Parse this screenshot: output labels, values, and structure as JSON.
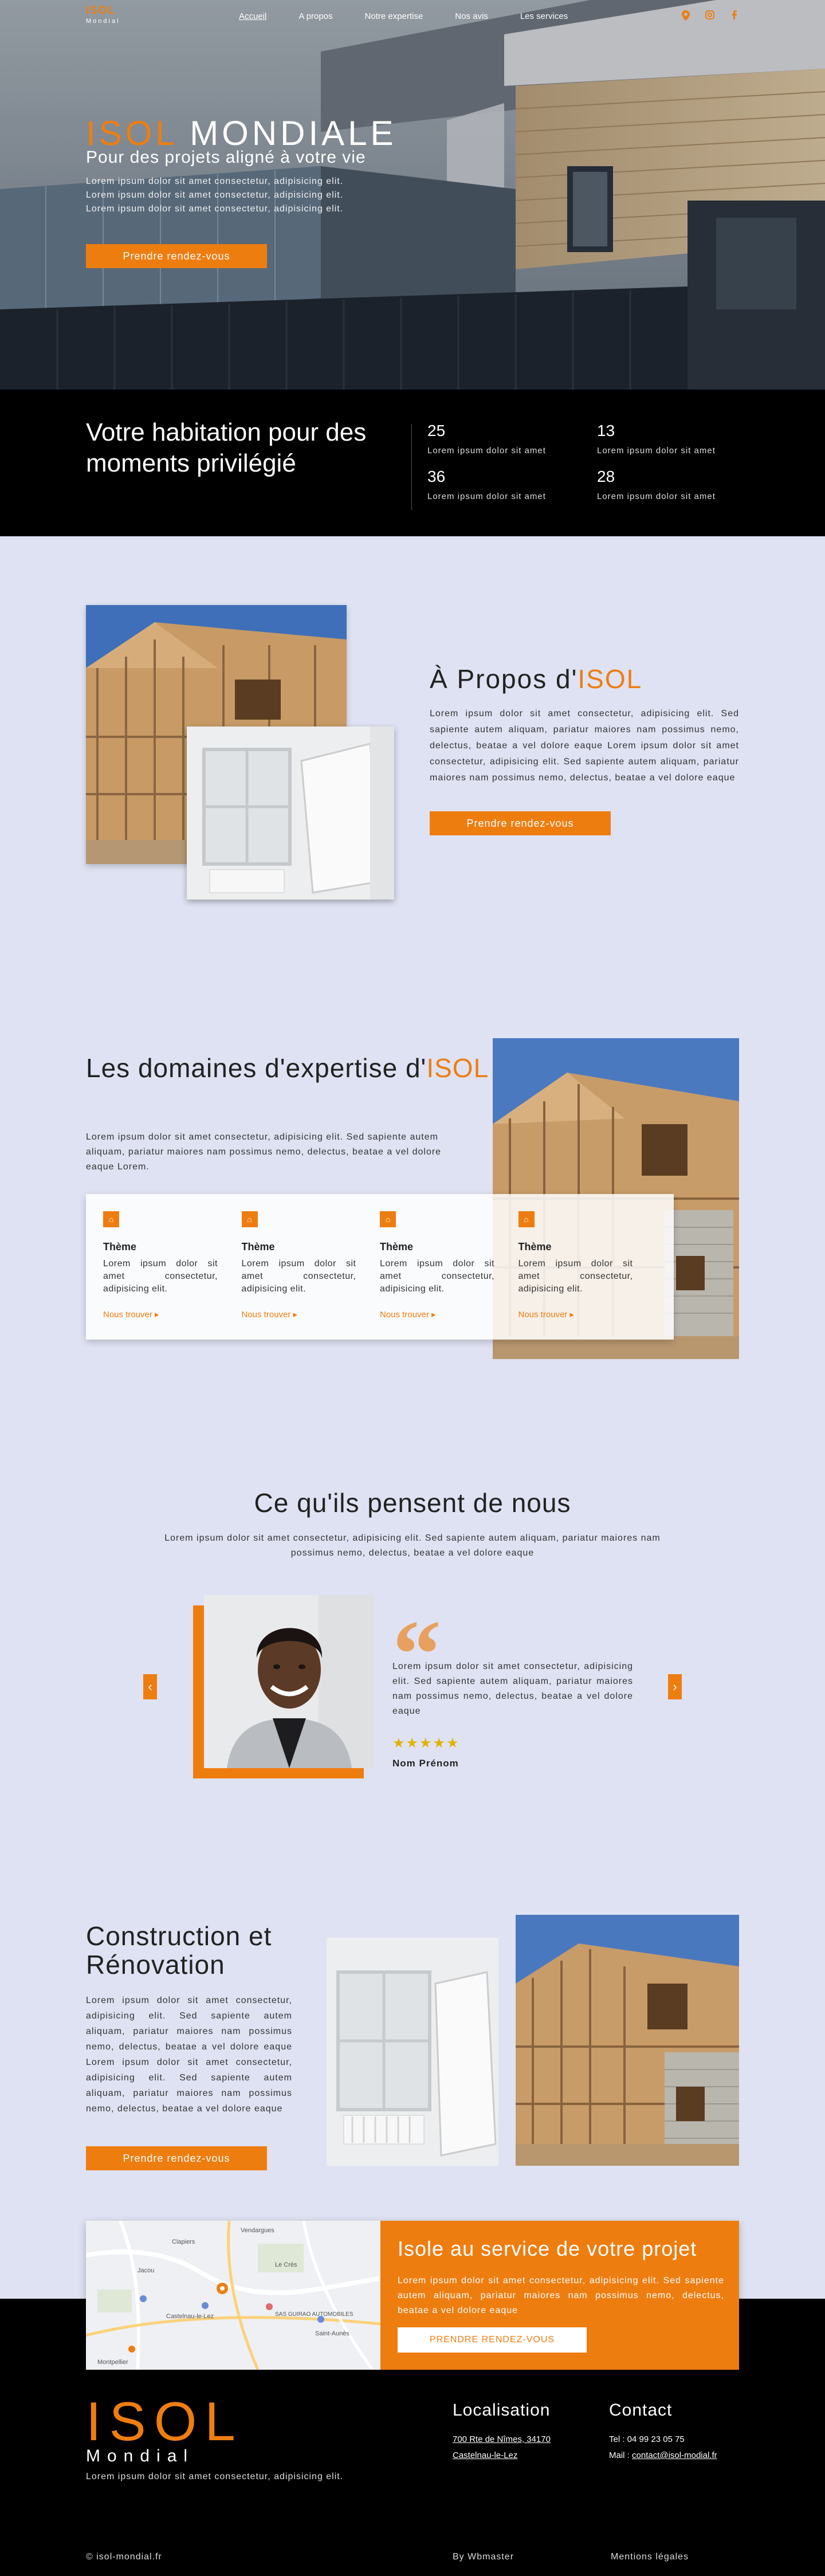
{
  "nav": {
    "logo_main": "ISOL",
    "logo_sub": "Mondial",
    "links": [
      "Accueil",
      "A propos",
      "Notre expertise",
      "Nos avis",
      "Les services"
    ]
  },
  "hero": {
    "title_accent": "ISOL",
    "title_rest": "MONDIALE",
    "subtitle": "Pour des projets aligné à votre vie",
    "text": "Lorem ipsum dolor sit amet consectetur, adipisicing elit. Lorem ipsum dolor sit amet consectetur, adipisicing elit. Lorem ipsum dolor sit amet consectetur, adipisicing elit.",
    "button": "Prendre rendez-vous"
  },
  "stats": {
    "title": "Votre habitation pour des moments privilégié",
    "items": [
      {
        "num": "25",
        "label": "Lorem ipsum dolor sit amet"
      },
      {
        "num": "13",
        "label": "Lorem ipsum dolor sit amet"
      },
      {
        "num": "36",
        "label": "Lorem ipsum dolor sit amet"
      },
      {
        "num": "28",
        "label": "Lorem ipsum dolor sit amet"
      }
    ]
  },
  "about": {
    "title_prefix": "À Propos d'",
    "title_accent": "ISOL",
    "text": "Lorem ipsum dolor sit amet consectetur, adipisicing elit. Sed sapiente autem aliquam, pariatur maiores nam possimus nemo, delectus, beatae a vel dolore eaque Lorem ipsum dolor sit amet consectetur, adipisicing elit. Sed sapiente autem aliquam, pariatur maiores nam possimus nemo, delectus, beatae a vel dolore eaque",
    "button": "Prendre rendez-vous"
  },
  "expertise": {
    "title_prefix": "Les domaines d'expertise d'",
    "title_accent": "ISOL",
    "text": "Lorem ipsum dolor sit amet consectetur, adipisicing elit. Sed sapiente autem aliquam, pariatur maiores nam possimus nemo, delectus, beatae a vel dolore eaque Lorem.",
    "cards": [
      {
        "title": "Thème",
        "text": "Lorem ipsum dolor sit amet consectetur, adipisicing elit.",
        "link": "Nous trouver"
      },
      {
        "title": "Thème",
        "text": "Lorem ipsum dolor sit amet consectetur, adipisicing elit.",
        "link": "Nous trouver"
      },
      {
        "title": "Thème",
        "text": "Lorem ipsum dolor sit amet consectetur, adipisicing elit.",
        "link": "Nous trouver"
      },
      {
        "title": "Thème",
        "text": "Lorem ipsum dolor sit amet consectetur, adipisicing elit.",
        "link": "Nous trouver"
      }
    ]
  },
  "testimonials": {
    "title": "Ce qu'ils pensent de nous",
    "subtitle": "Lorem ipsum dolor sit amet consectetur, adipisicing elit. Sed sapiente autem aliquam, pariatur maiores nam possimus nemo, delectus, beatae a vel dolore eaque",
    "quote": "Lorem ipsum dolor sit amet consectetur, adipisicing elit. Sed sapiente autem aliquam, pariatur maiores nam possimus nemo, delectus, beatae a vel dolore eaque",
    "stars": "★★★★★",
    "rating": 5,
    "name": "Nom Prénom"
  },
  "construction": {
    "title": "Construction et Rénovation",
    "text": "Lorem ipsum dolor sit amet consectetur, adipisicing elit. Sed sapiente autem aliquam, pariatur maiores nam possimus nemo, delectus, beatae a vel dolore eaque Lorem ipsum dolor sit amet consectetur, adipisicing elit. Sed sapiente autem aliquam, pariatur maiores nam possimus nemo, delectus, beatae a vel dolore eaque",
    "button": "Prendre rendez-vous"
  },
  "cta": {
    "title": "Isole au service de votre projet",
    "text": "Lorem ipsum dolor sit amet consectetur, adipisicing elit. Sed sapiente autem aliquam, pariatur maiores nam possimus nemo, delectus, beatae a vel dolore eaque",
    "button": "PRENDRE RENDEZ-VOUS",
    "map_labels": [
      "Vendargues",
      "Le Crès",
      "Castelnau-le-Lez",
      "Clapiers",
      "Jacou",
      "Montpellier",
      "Saint-Aunès",
      "SAS GUIRAO AUTOMOBILES"
    ]
  },
  "footer": {
    "logo_main": "ISOL",
    "logo_sub": "Mondial",
    "text": "Lorem ipsum dolor sit amet consectetur, adipisicing elit.",
    "loc_title": "Localisation",
    "address1": "700 Rte de Nîmes, 34170",
    "address2": "Castelnau-le-Lez",
    "contact_title": "Contact",
    "tel": "Tel : 04 99 23 05 75",
    "mail_label": "Mail : ",
    "mail": "contact@isol-modial.fr",
    "copyright": "© isol-mondial.fr",
    "credit": "By Wbmaster",
    "legal": "Mentions légales"
  },
  "colors": {
    "accent": "#ee7d10",
    "background": "#dfe2f2",
    "dark": "#000000"
  }
}
